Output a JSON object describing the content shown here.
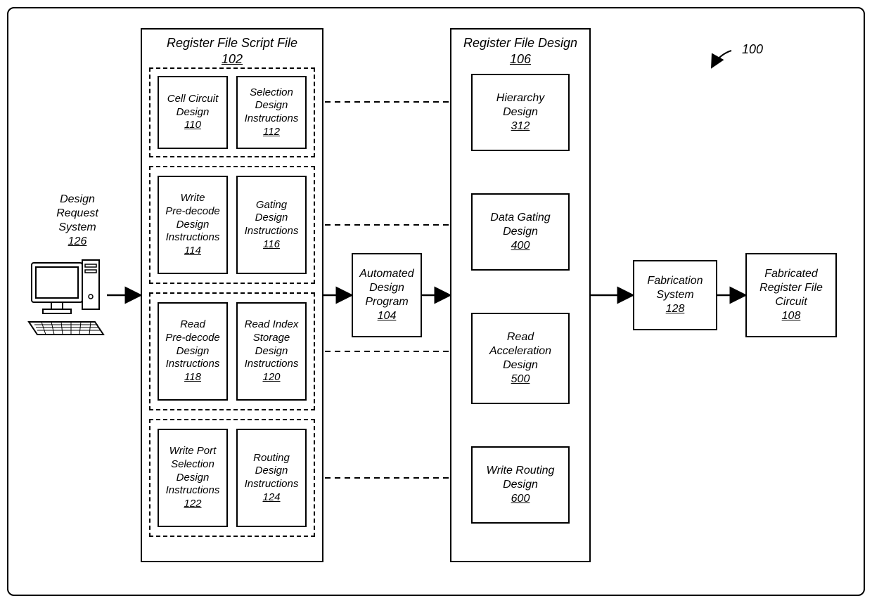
{
  "figure_ref": "100",
  "design_request_system": {
    "label": "Design\nRequest\nSystem",
    "ref": "126"
  },
  "script_file": {
    "title": "Register File Script File",
    "ref": "102",
    "group1": {
      "box_a": {
        "label": "Cell Circuit\nDesign",
        "ref": "110"
      },
      "box_b": {
        "label": "Selection\nDesign\nInstructions",
        "ref": "112"
      }
    },
    "group2": {
      "box_a": {
        "label": "Write\nPre-decode\nDesign\nInstructions",
        "ref": "114"
      },
      "box_b": {
        "label": "Gating\nDesign\nInstructions",
        "ref": "116"
      }
    },
    "group3": {
      "box_a": {
        "label": "Read\nPre-decode\nDesign\nInstructions",
        "ref": "118"
      },
      "box_b": {
        "label": "Read Index\nStorage\nDesign\nInstructions",
        "ref": "120"
      }
    },
    "group4": {
      "box_a": {
        "label": "Write Port\nSelection\nDesign\nInstructions",
        "ref": "122"
      },
      "box_b": {
        "label": "Routing\nDesign\nInstructions",
        "ref": "124"
      }
    }
  },
  "program": {
    "label": "Automated\nDesign\nProgram",
    "ref": "104"
  },
  "design": {
    "title": "Register File Design",
    "ref": "106",
    "b1": {
      "label": "Hierarchy\nDesign",
      "ref": "312"
    },
    "b2": {
      "label": "Data Gating\nDesign",
      "ref": "400"
    },
    "b3": {
      "label": "Read\nAcceleration\nDesign",
      "ref": "500"
    },
    "b4": {
      "label": "Write Routing\nDesign",
      "ref": "600"
    }
  },
  "fabrication": {
    "label": "Fabrication\nSystem",
    "ref": "128"
  },
  "fabricated": {
    "label": "Fabricated\nRegister File\nCircuit",
    "ref": "108"
  }
}
